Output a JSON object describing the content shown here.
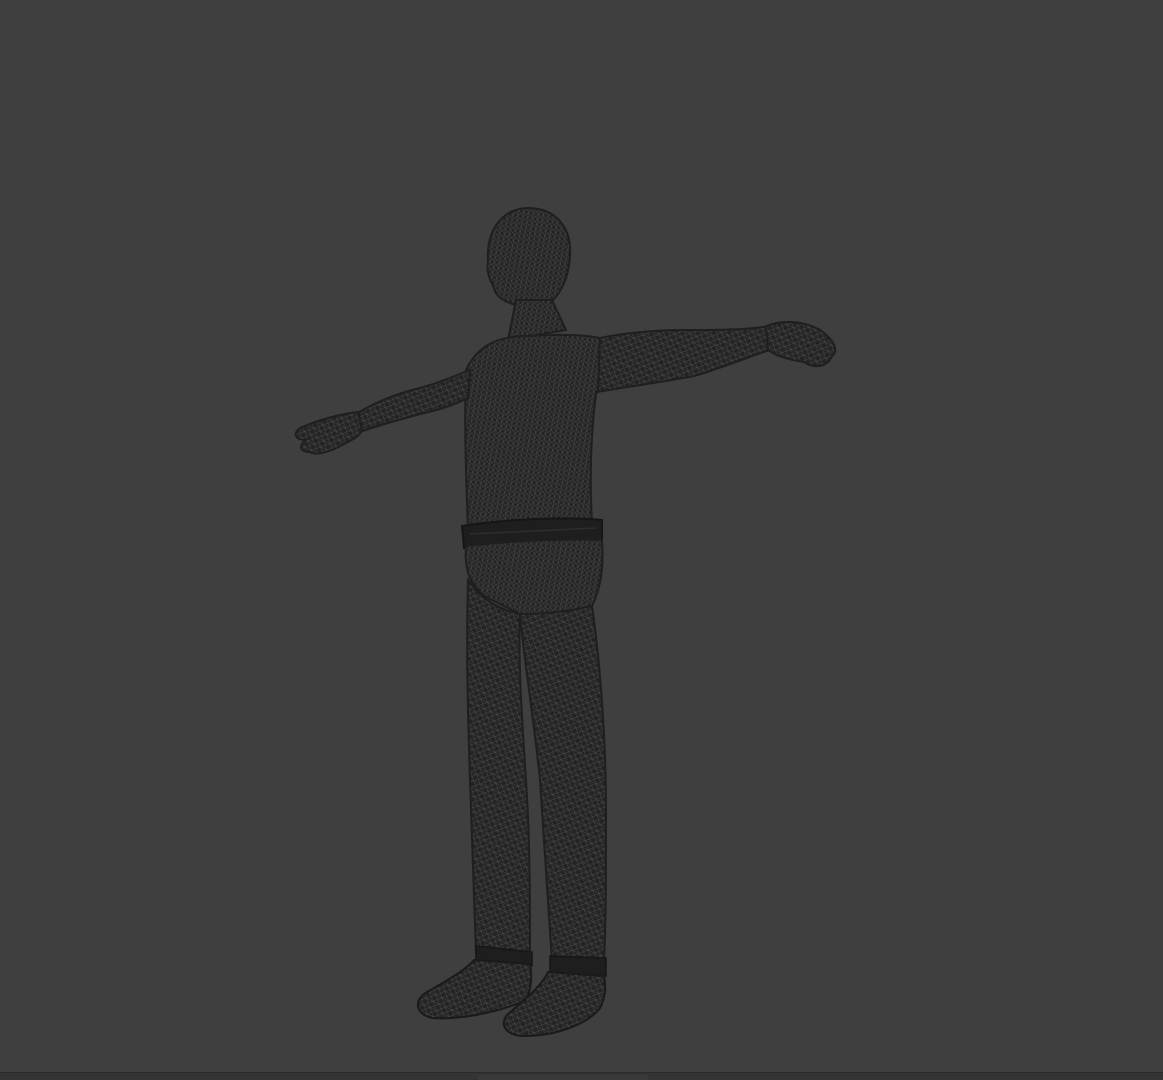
{
  "viewport": {
    "shading_mode": "wireframe",
    "background_color": "#3f3f3f",
    "model": {
      "pose": "T-pose",
      "mesh_color": "#222222",
      "wire_color": "#4a4a4a"
    }
  }
}
